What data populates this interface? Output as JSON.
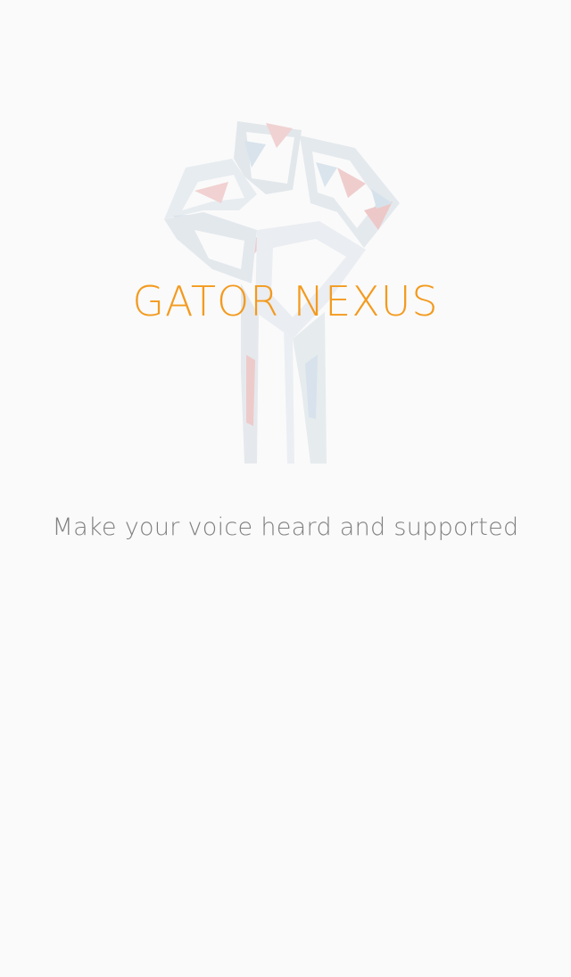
{
  "splash": {
    "app_name": "GATOR NEXUS",
    "tagline": "Make your voice heard and supported",
    "logo_icon": "raised-fist-icon"
  },
  "colors": {
    "background": "#fafafa",
    "title": "#f39a1e",
    "tagline": "#808080",
    "logo_gray": "#c9d3db",
    "logo_red": "#e6a5a5",
    "logo_blue": "#b9cfe0"
  }
}
